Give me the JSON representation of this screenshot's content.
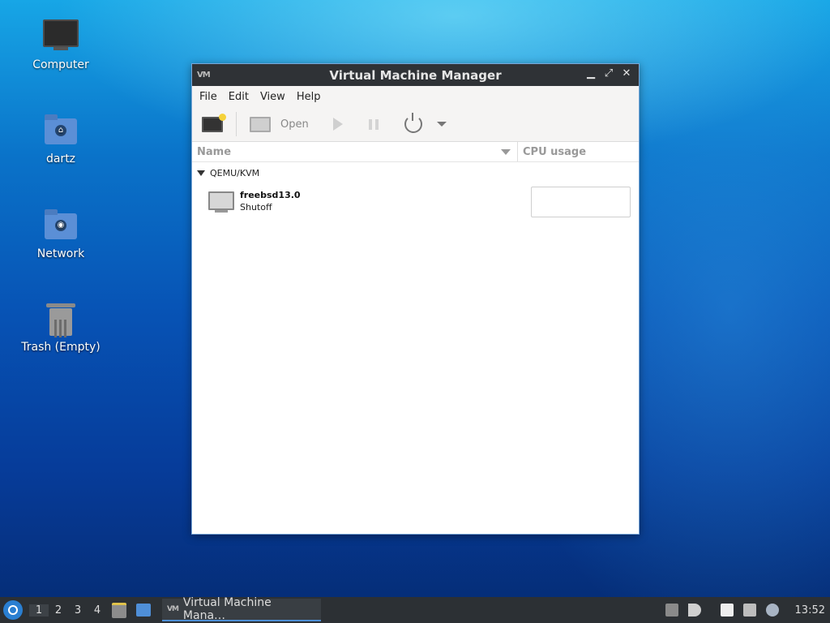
{
  "desktop": {
    "icons": [
      {
        "label": "Computer",
        "icon": "computer-icon"
      },
      {
        "label": "dartz",
        "icon": "home-folder-icon"
      },
      {
        "label": "Network",
        "icon": "network-folder-icon"
      },
      {
        "label": "Trash (Empty)",
        "icon": "trash-icon"
      }
    ]
  },
  "window": {
    "app_logo": "VM",
    "title": "Virtual Machine Manager",
    "controls": {
      "minimize": "▁",
      "maximize": "⤢",
      "close": "✕"
    },
    "menu": [
      "File",
      "Edit",
      "View",
      "Help"
    ],
    "toolbar": {
      "new_vm": "new-vm-icon",
      "open_label": "Open",
      "run": "run-icon",
      "pause": "pause-icon",
      "shutdown": "power-icon",
      "shutdown_menu": "chevron-down-icon"
    },
    "columns": {
      "name": "Name",
      "cpu": "CPU usage"
    },
    "connection": "QEMU/KVM",
    "vms": [
      {
        "name": "freebsd13.0",
        "status": "Shutoff"
      }
    ]
  },
  "taskbar": {
    "workspaces": [
      "1",
      "2",
      "3",
      "4"
    ],
    "active_workspace": "1",
    "task_logo": "VM",
    "task_label": "Virtual Machine Mana…",
    "clock": "13:52"
  },
  "colors": {
    "titlebar": "#2f3236",
    "taskbar": "#2c3034",
    "accent": "#4d8fd6"
  }
}
